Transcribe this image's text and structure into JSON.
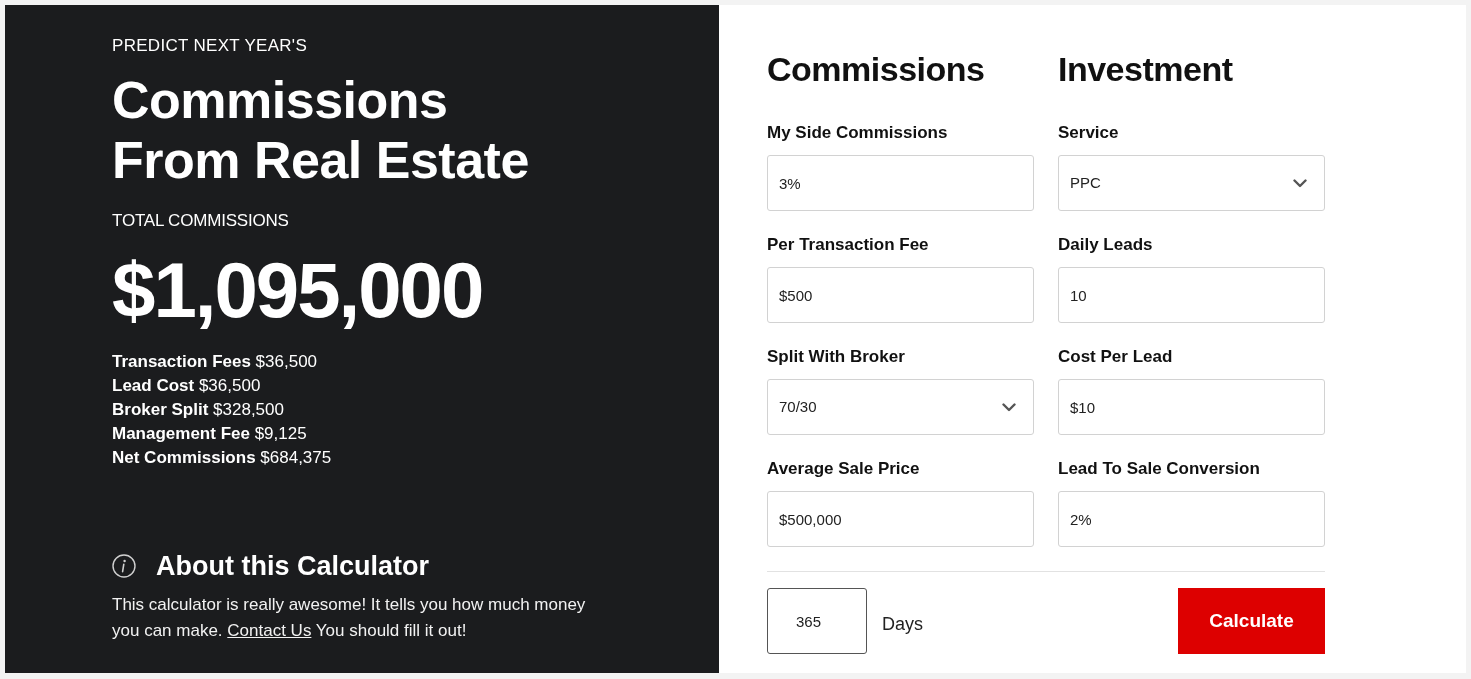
{
  "intro": {
    "eyebrow": "PREDICT NEXT YEAR'S",
    "title": [
      "Commissions",
      "From Real Estate"
    ],
    "total_label": "TOTAL COMMISSIONS",
    "total": "$1,095,000"
  },
  "breakdown": [
    "**Transaction Fees** $36,500",
    "**Lead Cost** $36,500",
    "**Broker Split** $328,500",
    "**Management Fee** $9,125",
    "**Net Commissions** $684,375"
  ],
  "about": {
    "title": "About this Calculator",
    "text": "This calculator is really awesome! It tells you how much money you can make.",
    "link": "Contact Us",
    "text_after": "You should fill it out!"
  },
  "form": {
    "columns": [
      {
        "heading": "Commissions",
        "fields": [
          {
            "label": "My Side Commissions",
            "kind": "text",
            "value": "3%"
          },
          {
            "label": "Per Transaction Fee",
            "kind": "text",
            "value": "$500"
          },
          {
            "label": "Split With Broker",
            "kind": "select",
            "value": "70/30"
          },
          {
            "label": "Average Sale Price",
            "kind": "text",
            "value": "$500,000"
          }
        ]
      },
      {
        "heading": "Investment",
        "fields": [
          {
            "label": "Service",
            "kind": "select",
            "value": "PPC"
          },
          {
            "label": "Daily Leads",
            "kind": "text",
            "value": "10"
          },
          {
            "label": "Cost Per Lead",
            "kind": "text",
            "value": "$10"
          },
          {
            "label": "Lead To Sale Conversion",
            "kind": "text",
            "value": "2%"
          }
        ]
      }
    ]
  },
  "footer": {
    "days": "365",
    "days_label": "Days",
    "button": "Calculate"
  }
}
